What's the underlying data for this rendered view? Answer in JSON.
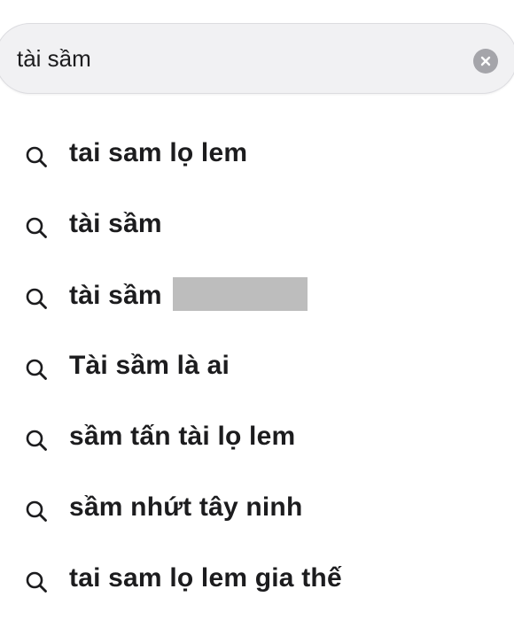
{
  "search": {
    "value": "tài sầm",
    "placeholder": ""
  },
  "icons": {
    "clear": "clear-circle-x-icon",
    "suggestion": "search-icon"
  },
  "colors": {
    "field_background": "#f1f1f3",
    "text": "#1c1c1e",
    "clear_button": "#a5a5aa",
    "redaction": "#bdbdbd"
  },
  "suggestions": [
    {
      "label": "tai sam lọ lem"
    },
    {
      "label": "tài sầm"
    },
    {
      "label": "tài sầm",
      "redacted_suffix": true
    },
    {
      "label": "Tài sầm là ai"
    },
    {
      "label": "sầm tấn tài lọ lem"
    },
    {
      "label": "sầm nhứt tây ninh"
    },
    {
      "label": "tai sam lọ lem gia thế"
    }
  ]
}
